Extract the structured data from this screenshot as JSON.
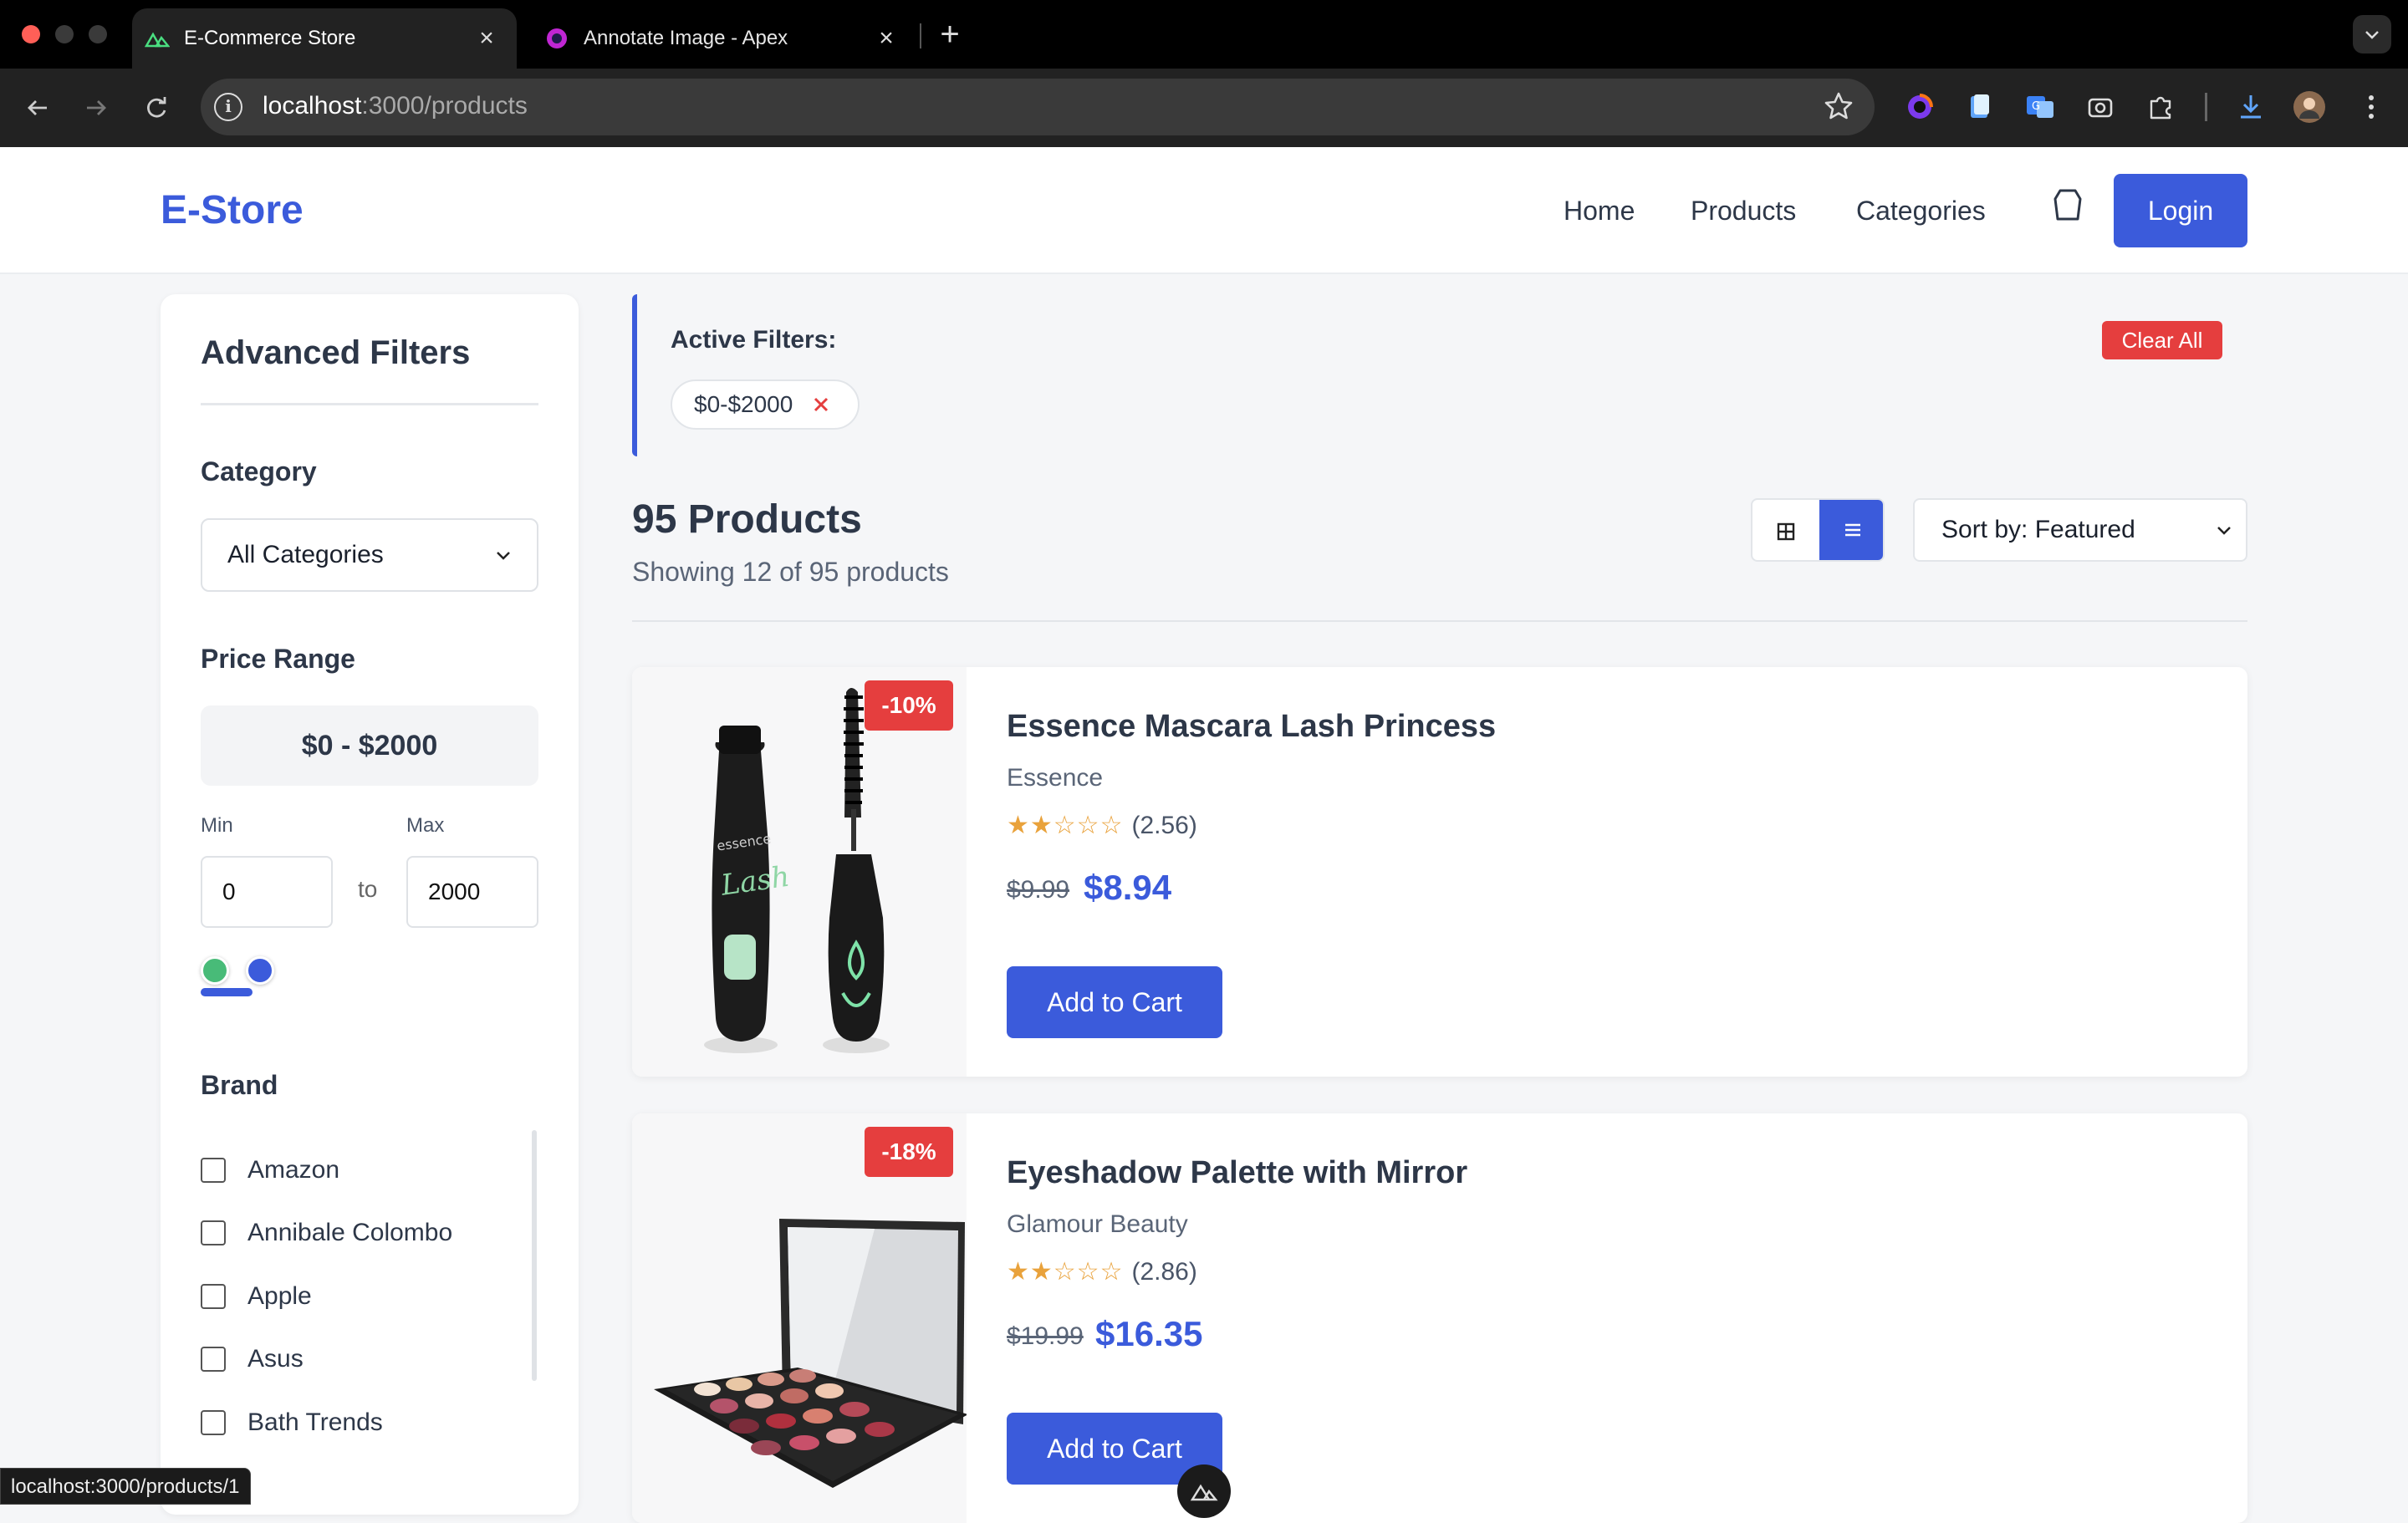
{
  "browser": {
    "tabs": [
      {
        "title": "E-Commerce Store",
        "icon": "nuxt-icon",
        "active": true
      },
      {
        "title": "Annotate Image - Apex",
        "icon": "apex-icon",
        "active": false
      }
    ],
    "url_host": "localhost",
    "url_path": ":3000/products"
  },
  "header": {
    "brand": "E-Store",
    "nav": [
      "Home",
      "Products",
      "Categories"
    ],
    "login_label": "Login"
  },
  "sidebar": {
    "title": "Advanced Filters",
    "category_label": "Category",
    "category_value": "All Categories",
    "price_label": "Price Range",
    "price_display": "$0 - $2000",
    "min_label": "Min",
    "max_label": "Max",
    "to_label": "to",
    "min_value": "0",
    "max_value": "2000",
    "brand_label": "Brand",
    "brands": [
      "Amazon",
      "Annibale Colombo",
      "Apple",
      "Asus",
      "Bath Trends"
    ]
  },
  "filters": {
    "title": "Active Filters:",
    "chips": [
      "$0-$2000"
    ],
    "clear_label": "Clear All"
  },
  "listing": {
    "count_title": "95 Products",
    "showing": "Showing 12 of 95 products",
    "sort_label": "Sort by: Featured",
    "view_mode": "list"
  },
  "products": [
    {
      "name": "Essence Mascara Lash Princess",
      "brand": "Essence",
      "discount": "-10%",
      "rating_stars": 2,
      "rating": "(2.56)",
      "old_price": "$9.99",
      "price": "$8.94",
      "cta": "Add to Cart"
    },
    {
      "name": "Eyeshadow Palette with Mirror",
      "brand": "Glamour Beauty",
      "discount": "-18%",
      "rating_stars": 2,
      "rating": "(2.86)",
      "old_price": "$19.99",
      "price": "$16.35",
      "cta": "Add to Cart"
    }
  ],
  "status_url": "localhost:3000/products/1",
  "colors": {
    "accent": "#3b5bdb",
    "danger": "#e53e3e",
    "star": "#e9a23b"
  }
}
